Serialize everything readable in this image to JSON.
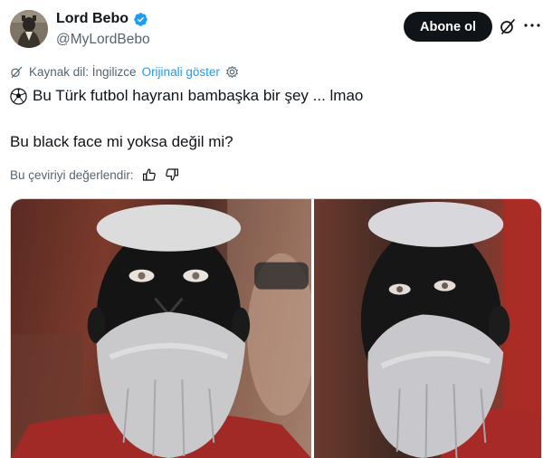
{
  "author": {
    "name": "Lord Bebo",
    "handle": "@MyLordBebo",
    "verified": true
  },
  "actions": {
    "follow_label": "Abone ol"
  },
  "translation": {
    "source_label": "Kaynak dil: İngilizce",
    "show_original": "Orijinali göster",
    "rate_label": "Bu çeviriyi değerlendir:"
  },
  "tweet": {
    "line1": "Bu Türk futbol hayranı bambaşka bir şey ... lmao",
    "line2": "Bu black face mi yoksa değil mi?"
  },
  "colors": {
    "accent": "#1d9bf0",
    "text": "#0f1419",
    "muted": "#536471",
    "button": "#0f1419"
  },
  "icons": [
    "verified-badge-icon",
    "grok-icon",
    "more-icon",
    "translate-icon",
    "settings-icon",
    "soccer-ball-icon",
    "thumbs-up-icon",
    "thumbs-down-icon"
  ]
}
